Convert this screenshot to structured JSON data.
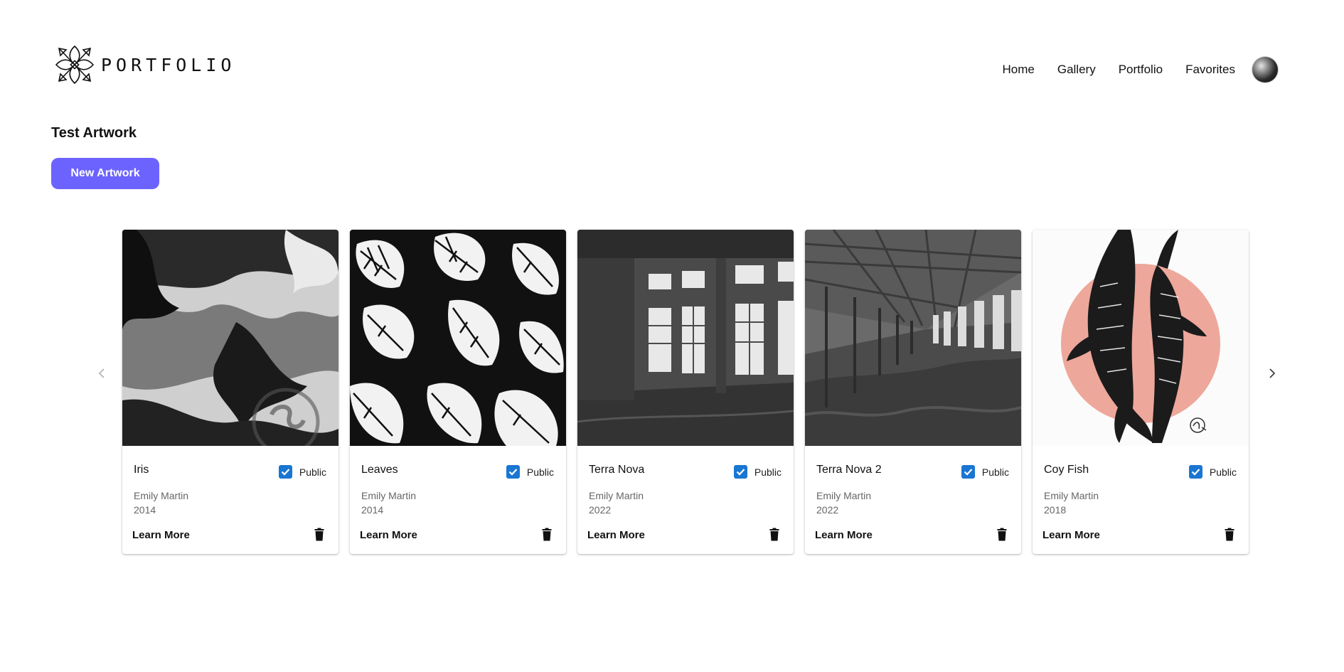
{
  "header": {
    "logo_text": "PORTFOLIO",
    "logo_icon": "flower-ornament-icon",
    "nav": [
      {
        "label": "Home"
      },
      {
        "label": "Gallery"
      },
      {
        "label": "Portfolio"
      },
      {
        "label": "Favorites"
      }
    ],
    "avatar_icon": "user-avatar"
  },
  "main": {
    "title": "Test Artwork",
    "new_button_label": "New Artwork",
    "accent_color": "#6c63ff",
    "checkbox_color": "#1976d2",
    "carousel": {
      "prev_icon": "chevron-left-icon",
      "next_icon": "chevron-right-icon",
      "cards": [
        {
          "title": "Iris",
          "author": "Emily Martin",
          "year": "2014",
          "public_label": "Public",
          "public_checked": true,
          "action_label": "Learn More",
          "delete_icon": "trash-icon"
        },
        {
          "title": "Leaves",
          "author": "Emily Martin",
          "year": "2014",
          "public_label": "Public",
          "public_checked": true,
          "action_label": "Learn More",
          "delete_icon": "trash-icon"
        },
        {
          "title": "Terra Nova",
          "author": "Emily Martin",
          "year": "2022",
          "public_label": "Public",
          "public_checked": true,
          "action_label": "Learn More",
          "delete_icon": "trash-icon"
        },
        {
          "title": "Terra Nova 2",
          "author": "Emily Martin",
          "year": "2022",
          "public_label": "Public",
          "public_checked": true,
          "action_label": "Learn More",
          "delete_icon": "trash-icon"
        },
        {
          "title": "Coy Fish",
          "author": "Emily Martin",
          "year": "2018",
          "public_label": "Public",
          "public_checked": true,
          "action_label": "Learn More",
          "delete_icon": "trash-icon"
        }
      ]
    }
  }
}
